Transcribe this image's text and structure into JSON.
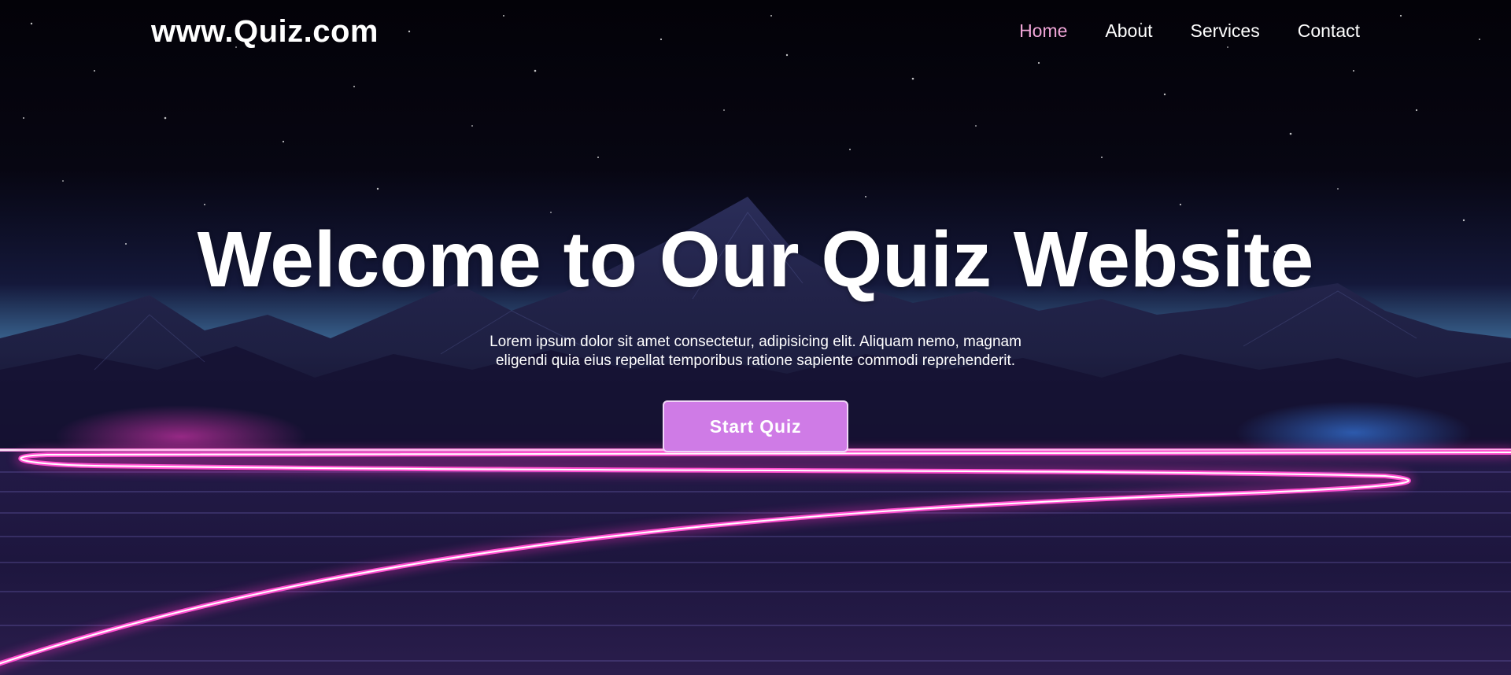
{
  "header": {
    "logo": "www.Quiz.com",
    "nav": [
      {
        "label": "Home",
        "active": true
      },
      {
        "label": "About",
        "active": false
      },
      {
        "label": "Services",
        "active": false
      },
      {
        "label": "Contact",
        "active": false
      }
    ]
  },
  "hero": {
    "title": "Welcome to Our Quiz Website",
    "description": "Lorem ipsum dolor sit amet consectetur, adipisicing elit. Aliquam nemo, magnam eligendi quia eius repellat temporibus ratione sapiente commodi reprehenderit.",
    "cta_label": "Start Quiz"
  },
  "colors": {
    "accent": "#cf7be6",
    "nav_active": "#f0a6d8",
    "neon": "#ff3cc8",
    "sky": "#05040c"
  }
}
